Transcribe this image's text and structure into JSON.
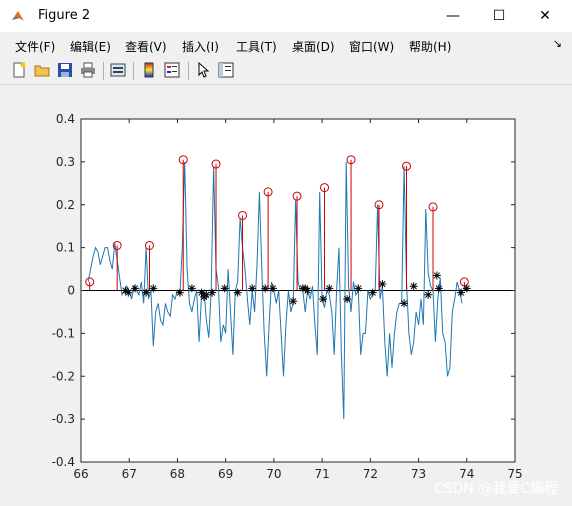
{
  "window": {
    "title": "Figure 2"
  },
  "controls": {
    "minimize": "—",
    "maximize": "☐",
    "close": "✕"
  },
  "menu": [
    {
      "label": "文件(F)"
    },
    {
      "label": "编辑(E)"
    },
    {
      "label": "查看(V)"
    },
    {
      "label": "插入(I)"
    },
    {
      "label": "工具(T)"
    },
    {
      "label": "桌面(D)"
    },
    {
      "label": "窗口(W)"
    },
    {
      "label": "帮助(H)"
    }
  ],
  "toolbar_icons": [
    "new-figure-icon",
    "open-file-icon",
    "save-icon",
    "print-icon",
    "print-preview-icon",
    "colorbar-icon",
    "legend-icon",
    "pointer-icon",
    "property-editor-icon"
  ],
  "watermark": "CSDN @我爱C编程",
  "chart_data": {
    "type": "line",
    "xlim": [
      66,
      75
    ],
    "ylim": [
      -0.4,
      0.4
    ],
    "xticks": [
      66,
      67,
      68,
      69,
      70,
      71,
      72,
      73,
      74,
      75
    ],
    "yticks": [
      -0.4,
      -0.3,
      -0.2,
      -0.1,
      0,
      0.1,
      0.2,
      0.3,
      0.4
    ],
    "xtick_labels": [
      "66",
      "67",
      "68",
      "69",
      "70",
      "71",
      "72",
      "73",
      "74",
      "75"
    ],
    "ytick_labels": [
      "-0.4",
      "-0.3",
      "-0.2",
      "-0.1",
      "0",
      "0.1",
      "0.2",
      "0.3",
      "0.4"
    ],
    "colors": {
      "signal": "#1f77b4",
      "peaks": "#cc0000",
      "valleys": "#000000",
      "zero": "#000000"
    },
    "signal": {
      "x": [
        66.15,
        66.2,
        66.25,
        66.3,
        66.35,
        66.4,
        66.45,
        66.5,
        66.55,
        66.6,
        66.65,
        66.7,
        66.75,
        66.8,
        66.85,
        66.9,
        66.95,
        67.0,
        67.05,
        67.1,
        67.15,
        67.2,
        67.25,
        67.3,
        67.35,
        67.4,
        67.45,
        67.5,
        67.55,
        67.6,
        67.65,
        67.7,
        67.75,
        67.8,
        67.85,
        67.9,
        67.95,
        68.0,
        68.05,
        68.1,
        68.15,
        68.2,
        68.25,
        68.3,
        68.35,
        68.4,
        68.45,
        68.5,
        68.55,
        68.6,
        68.65,
        68.7,
        68.75,
        68.8,
        68.85,
        68.9,
        68.95,
        69.0,
        69.05,
        69.1,
        69.15,
        69.2,
        69.25,
        69.3,
        69.35,
        69.4,
        69.45,
        69.5,
        69.55,
        69.6,
        69.65,
        69.7,
        69.75,
        69.8,
        69.85,
        69.9,
        69.95,
        70.0,
        70.05,
        70.1,
        70.15,
        70.2,
        70.25,
        70.3,
        70.35,
        70.4,
        70.45,
        70.5,
        70.55,
        70.6,
        70.65,
        70.7,
        70.75,
        70.8,
        70.85,
        70.9,
        70.95,
        71.0,
        71.05,
        71.1,
        71.15,
        71.2,
        71.25,
        71.3,
        71.35,
        71.4,
        71.45,
        71.5,
        71.55,
        71.6,
        71.65,
        71.7,
        71.75,
        71.8,
        71.85,
        71.9,
        71.95,
        72.0,
        72.05,
        72.1,
        72.15,
        72.2,
        72.25,
        72.3,
        72.35,
        72.4,
        72.45,
        72.5,
        72.55,
        72.6,
        72.65,
        72.7,
        72.75,
        72.8,
        72.85,
        72.9,
        72.95,
        73.0,
        73.05,
        73.1,
        73.15,
        73.2,
        73.25,
        73.3,
        73.35,
        73.4,
        73.45,
        73.5,
        73.55,
        73.6,
        73.65,
        73.7,
        73.75,
        73.8,
        73.85,
        73.9,
        73.95,
        74.0
      ],
      "y": [
        0.02,
        0.05,
        0.08,
        0.1,
        0.09,
        0.06,
        0.08,
        0.1,
        0.1,
        0.07,
        0.05,
        0.11,
        0.07,
        0.03,
        -0.01,
        0.0,
        0.01,
        0.0,
        -0.02,
        0.01,
        0.0,
        -0.01,
        0.02,
        -0.03,
        0.1,
        -0.02,
        0.0,
        -0.13,
        -0.05,
        -0.03,
        -0.07,
        -0.08,
        -0.03,
        -0.05,
        -0.06,
        -0.01,
        -0.02,
        0.0,
        -0.01,
        0.1,
        0.3,
        0.05,
        -0.03,
        -0.05,
        -0.02,
        0.0,
        -0.12,
        -0.01,
        0.0,
        -0.07,
        -0.11,
        0.0,
        0.29,
        0.05,
        0.01,
        -0.12,
        -0.08,
        -0.1,
        0.05,
        -0.05,
        -0.15,
        0.0,
        0.02,
        0.17,
        0.1,
        0.05,
        -0.02,
        -0.08,
        0.0,
        -0.05,
        0.06,
        0.23,
        0.05,
        -0.1,
        -0.2,
        -0.08,
        0.02,
        0.0,
        -0.03,
        0.0,
        -0.1,
        -0.2,
        -0.08,
        0.0,
        -0.05,
        -0.03,
        0.21,
        0.02,
        0.0,
        0.0,
        -0.05,
        0.0,
        -0.02,
        0.01,
        -0.08,
        -0.15,
        0.23,
        -0.02,
        -0.04,
        0.0,
        -0.01,
        -0.05,
        -0.15,
        0.0,
        0.1,
        -0.15,
        -0.3,
        0.3,
        0.01,
        -0.05,
        0.02,
        -0.01,
        0.0,
        -0.15,
        -0.1,
        -0.1,
        0.0,
        -0.02,
        -0.01,
        0.0,
        0.2,
        -0.02,
        0.01,
        -0.12,
        -0.2,
        -0.1,
        -0.18,
        -0.1,
        -0.05,
        -0.03,
        -0.03,
        0.29,
        0.02,
        -0.1,
        -0.15,
        -0.12,
        -0.05,
        -0.08,
        -0.02,
        -0.08,
        0.19,
        0.04,
        0.01,
        0.0,
        -0.12,
        -0.02,
        0.03,
        -0.1,
        -0.12,
        -0.2,
        -0.18,
        -0.05,
        -0.02,
        0.02,
        0.0,
        -0.03
      ]
    },
    "peaks": {
      "x": [
        66.18,
        66.75,
        67.42,
        68.12,
        68.8,
        69.35,
        69.88,
        70.48,
        71.05,
        71.6,
        72.18,
        72.75,
        73.3,
        73.95
      ],
      "y": [
        0.02,
        0.105,
        0.105,
        0.305,
        0.295,
        0.175,
        0.23,
        0.22,
        0.24,
        0.305,
        0.2,
        0.29,
        0.195,
        0.02
      ]
    },
    "valleys": {
      "x": [
        66.92,
        66.98,
        67.12,
        67.35,
        67.5,
        68.05,
        68.3,
        68.5,
        68.55,
        68.6,
        68.72,
        68.98,
        69.25,
        69.55,
        69.82,
        69.98,
        70.4,
        70.6,
        70.65,
        70.7,
        71.02,
        71.15,
        71.52,
        71.75,
        72.05,
        72.25,
        72.7,
        72.9,
        73.2,
        73.38,
        73.42,
        73.88,
        74.0
      ],
      "y": [
        0.0,
        -0.005,
        0.005,
        -0.005,
        0.005,
        -0.005,
        0.005,
        -0.005,
        -0.015,
        -0.01,
        -0.005,
        0.005,
        -0.005,
        0.005,
        0.005,
        0.005,
        -0.025,
        0.005,
        0.005,
        0.0,
        -0.02,
        0.005,
        -0.02,
        0.005,
        -0.005,
        0.015,
        -0.03,
        0.01,
        -0.01,
        0.035,
        0.005,
        -0.005,
        0.005
      ]
    }
  }
}
